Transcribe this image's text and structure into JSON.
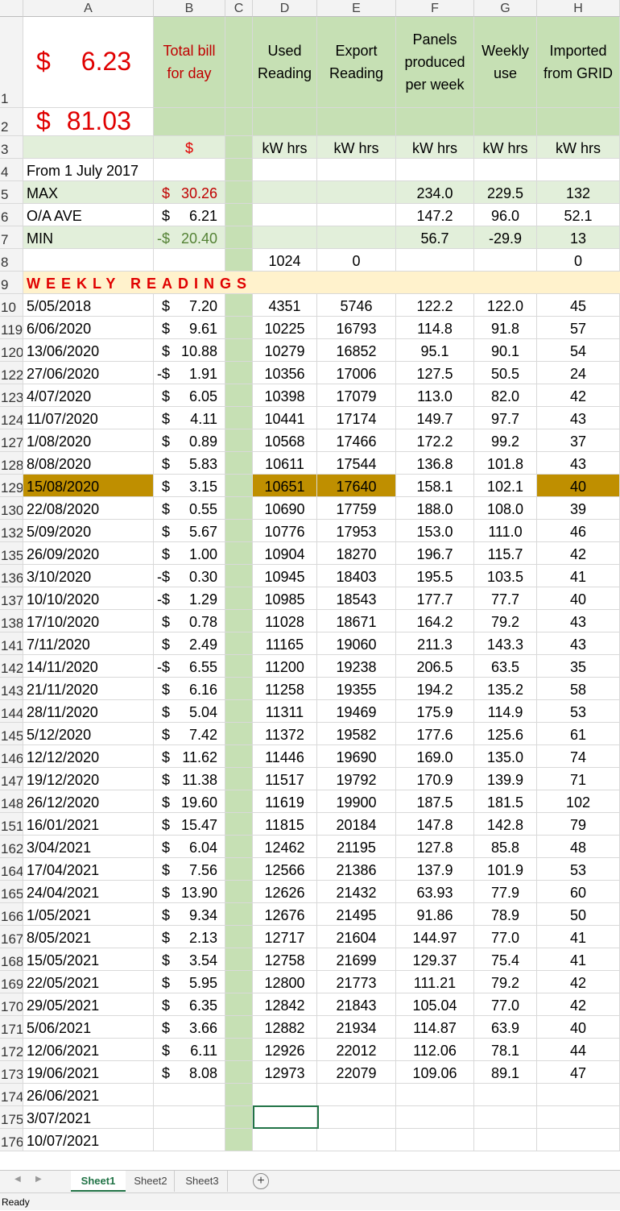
{
  "columns": [
    "A",
    "B",
    "C",
    "D",
    "E",
    "F",
    "G",
    "H"
  ],
  "header": {
    "rownum1": "1",
    "rownum2": "2",
    "big_value_1": "6.23",
    "big_value_2": "81.03",
    "currency": "$",
    "b_label": "Total bill for day",
    "d_label": "Used Reading",
    "e_label": "Export Reading",
    "f_label": "Panels produced per week",
    "g_label": "Weekly use",
    "h_label": "Imported from GRID"
  },
  "row3": {
    "num": "3",
    "b": "$",
    "d": "kW hrs",
    "e": "kW hrs",
    "f": "kW hrs",
    "g": "kW hrs",
    "h": "kW hrs"
  },
  "row4": {
    "num": "4",
    "a": "From 1 July 2017"
  },
  "row5": {
    "num": "5",
    "a": "MAX",
    "b_sign": "$",
    "b": "30.26",
    "f": "234.0",
    "g": "229.5",
    "h": "132"
  },
  "row6": {
    "num": "6",
    "a": "O/A AVE",
    "b_sign": "$",
    "b": "6.21",
    "f": "147.2",
    "g": "96.0",
    "h": "52.1"
  },
  "row7": {
    "num": "7",
    "a": "MIN",
    "b_sign": "-$",
    "b": "20.40",
    "f": "56.7",
    "g": "-29.9",
    "h": "13"
  },
  "row8": {
    "num": "8",
    "d": "1024",
    "e": "0",
    "h": "0"
  },
  "row9": {
    "num": "9",
    "a": "WEEKLY READINGS"
  },
  "rows": [
    {
      "num": "10",
      "a": "5/05/2018",
      "s": "$",
      "b": "7.20",
      "d": "4351",
      "e": "5746",
      "f": "122.2",
      "g": "122.0",
      "h": "45"
    },
    {
      "num": "119",
      "a": "6/06/2020",
      "s": "$",
      "b": "9.61",
      "d": "10225",
      "e": "16793",
      "f": "114.8",
      "g": "91.8",
      "h": "57"
    },
    {
      "num": "120",
      "a": "13/06/2020",
      "s": "$",
      "b": "10.88",
      "d": "10279",
      "e": "16852",
      "f": "95.1",
      "g": "90.1",
      "h": "54"
    },
    {
      "num": "122",
      "a": "27/06/2020",
      "s": "-$",
      "b": "1.91",
      "d": "10356",
      "e": "17006",
      "f": "127.5",
      "g": "50.5",
      "h": "24"
    },
    {
      "num": "123",
      "a": "4/07/2020",
      "s": "$",
      "b": "6.05",
      "d": "10398",
      "e": "17079",
      "f": "113.0",
      "g": "82.0",
      "h": "42"
    },
    {
      "num": "124",
      "a": "11/07/2020",
      "s": "$",
      "b": "4.11",
      "d": "10441",
      "e": "17174",
      "f": "149.7",
      "g": "97.7",
      "h": "43"
    },
    {
      "num": "127",
      "a": "1/08/2020",
      "s": "$",
      "b": "0.89",
      "d": "10568",
      "e": "17466",
      "f": "172.2",
      "g": "99.2",
      "h": "37"
    },
    {
      "num": "128",
      "a": "8/08/2020",
      "s": "$",
      "b": "5.83",
      "d": "10611",
      "e": "17544",
      "f": "136.8",
      "g": "101.8",
      "h": "43"
    },
    {
      "num": "129",
      "a": "15/08/2020",
      "s": "$",
      "b": "3.15",
      "d": "10651",
      "e": "17640",
      "f": "158.1",
      "g": "102.1",
      "h": "40",
      "highlight": true
    },
    {
      "num": "130",
      "a": "22/08/2020",
      "s": "$",
      "b": "0.55",
      "d": "10690",
      "e": "17759",
      "f": "188.0",
      "g": "108.0",
      "h": "39"
    },
    {
      "num": "132",
      "a": "5/09/2020",
      "s": "$",
      "b": "5.67",
      "d": "10776",
      "e": "17953",
      "f": "153.0",
      "g": "111.0",
      "h": "46"
    },
    {
      "num": "135",
      "a": "26/09/2020",
      "s": "$",
      "b": "1.00",
      "d": "10904",
      "e": "18270",
      "f": "196.7",
      "g": "115.7",
      "h": "42"
    },
    {
      "num": "136",
      "a": "3/10/2020",
      "s": "-$",
      "b": "0.30",
      "d": "10945",
      "e": "18403",
      "f": "195.5",
      "g": "103.5",
      "h": "41"
    },
    {
      "num": "137",
      "a": "10/10/2020",
      "s": "-$",
      "b": "1.29",
      "d": "10985",
      "e": "18543",
      "f": "177.7",
      "g": "77.7",
      "h": "40"
    },
    {
      "num": "138",
      "a": "17/10/2020",
      "s": "$",
      "b": "0.78",
      "d": "11028",
      "e": "18671",
      "f": "164.2",
      "g": "79.2",
      "h": "43"
    },
    {
      "num": "141",
      "a": "7/11/2020",
      "s": "$",
      "b": "2.49",
      "d": "11165",
      "e": "19060",
      "f": "211.3",
      "g": "143.3",
      "h": "43"
    },
    {
      "num": "142",
      "a": "14/11/2020",
      "s": "-$",
      "b": "6.55",
      "d": "11200",
      "e": "19238",
      "f": "206.5",
      "g": "63.5",
      "h": "35"
    },
    {
      "num": "143",
      "a": "21/11/2020",
      "s": "$",
      "b": "6.16",
      "d": "11258",
      "e": "19355",
      "f": "194.2",
      "g": "135.2",
      "h": "58"
    },
    {
      "num": "144",
      "a": "28/11/2020",
      "s": "$",
      "b": "5.04",
      "d": "11311",
      "e": "19469",
      "f": "175.9",
      "g": "114.9",
      "h": "53"
    },
    {
      "num": "145",
      "a": "5/12/2020",
      "s": "$",
      "b": "7.42",
      "d": "11372",
      "e": "19582",
      "f": "177.6",
      "g": "125.6",
      "h": "61"
    },
    {
      "num": "146",
      "a": "12/12/2020",
      "s": "$",
      "b": "11.62",
      "d": "11446",
      "e": "19690",
      "f": "169.0",
      "g": "135.0",
      "h": "74"
    },
    {
      "num": "147",
      "a": "19/12/2020",
      "s": "$",
      "b": "11.38",
      "d": "11517",
      "e": "19792",
      "f": "170.9",
      "g": "139.9",
      "h": "71"
    },
    {
      "num": "148",
      "a": "26/12/2020",
      "s": "$",
      "b": "19.60",
      "d": "11619",
      "e": "19900",
      "f": "187.5",
      "g": "181.5",
      "h": "102"
    },
    {
      "num": "151",
      "a": "16/01/2021",
      "s": "$",
      "b": "15.47",
      "d": "11815",
      "e": "20184",
      "f": "147.8",
      "g": "142.8",
      "h": "79"
    },
    {
      "num": "162",
      "a": "3/04/2021",
      "s": "$",
      "b": "6.04",
      "d": "12462",
      "e": "21195",
      "f": "127.8",
      "g": "85.8",
      "h": "48"
    },
    {
      "num": "164",
      "a": "17/04/2021",
      "s": "$",
      "b": "7.56",
      "d": "12566",
      "e": "21386",
      "f": "137.9",
      "g": "101.9",
      "h": "53"
    },
    {
      "num": "165",
      "a": "24/04/2021",
      "s": "$",
      "b": "13.90",
      "d": "12626",
      "e": "21432",
      "f": "63.93",
      "g": "77.9",
      "h": "60"
    },
    {
      "num": "166",
      "a": "1/05/2021",
      "s": "$",
      "b": "9.34",
      "d": "12676",
      "e": "21495",
      "f": "91.86",
      "g": "78.9",
      "h": "50"
    },
    {
      "num": "167",
      "a": "8/05/2021",
      "s": "$",
      "b": "2.13",
      "d": "12717",
      "e": "21604",
      "f": "144.97",
      "g": "77.0",
      "h": "41"
    },
    {
      "num": "168",
      "a": "15/05/2021",
      "s": "$",
      "b": "3.54",
      "d": "12758",
      "e": "21699",
      "f": "129.37",
      "g": "75.4",
      "h": "41"
    },
    {
      "num": "169",
      "a": "22/05/2021",
      "s": "$",
      "b": "5.95",
      "d": "12800",
      "e": "21773",
      "f": "111.21",
      "g": "79.2",
      "h": "42"
    },
    {
      "num": "170",
      "a": "29/05/2021",
      "s": "$",
      "b": "6.35",
      "d": "12842",
      "e": "21843",
      "f": "105.04",
      "g": "77.0",
      "h": "42"
    },
    {
      "num": "171",
      "a": "5/06/2021",
      "s": "$",
      "b": "3.66",
      "d": "12882",
      "e": "21934",
      "f": "114.87",
      "g": "63.9",
      "h": "40"
    },
    {
      "num": "172",
      "a": "12/06/2021",
      "s": "$",
      "b": "6.11",
      "d": "12926",
      "e": "22012",
      "f": "112.06",
      "g": "78.1",
      "h": "44"
    },
    {
      "num": "173",
      "a": "19/06/2021",
      "s": "$",
      "b": "8.08",
      "d": "12973",
      "e": "22079",
      "f": "109.06",
      "g": "89.1",
      "h": "47"
    },
    {
      "num": "174",
      "a": "26/06/2021",
      "s": "",
      "b": "",
      "d": "",
      "e": "",
      "f": "",
      "g": "",
      "h": ""
    },
    {
      "num": "175",
      "a": "3/07/2021",
      "s": "",
      "b": "",
      "d": "",
      "e": "",
      "f": "",
      "g": "",
      "h": ""
    },
    {
      "num": "176",
      "a": "10/07/2021",
      "s": "",
      "b": "",
      "d": "",
      "e": "",
      "f": "",
      "g": "",
      "h": ""
    }
  ],
  "tabs": [
    "Sheet1",
    "Sheet2",
    "Sheet3"
  ],
  "add_sheet": "+",
  "status": "Ready",
  "colors": {
    "accent": "#217346",
    "header_green": "#c6e0b4",
    "row_green": "#e2efda",
    "highlight": "#bf8f00",
    "banner": "#fff2cc",
    "red": "#e00000"
  }
}
